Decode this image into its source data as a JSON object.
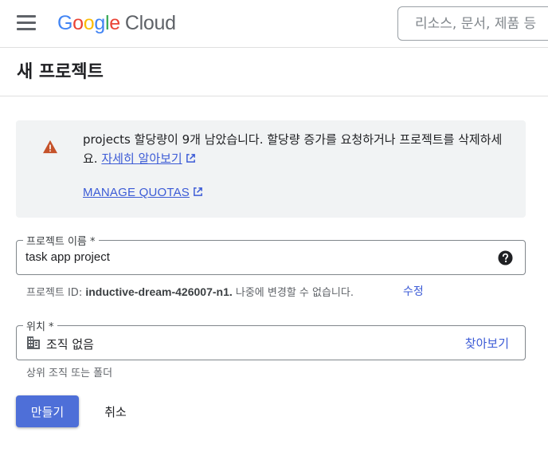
{
  "header": {
    "logo_google": [
      "G",
      "o",
      "o",
      "g",
      "l",
      "e"
    ],
    "logo_google_colors": [
      "#4285F4",
      "#EA4335",
      "#FBBC05",
      "#4285F4",
      "#34A853",
      "#EA4335"
    ],
    "logo_cloud": "Cloud",
    "search_placeholder": "리소스, 문서, 제품 등"
  },
  "page": {
    "title": "새 프로젝트"
  },
  "banner": {
    "message": "projects 할당량이 9개 남았습니다. 할당량 증가를 요청하거나 프로젝트를 삭제하세요.",
    "learn_more": "자세히 알아보기",
    "manage_quotas": "MANAGE QUOTAS",
    "warning_color": "#c5522a"
  },
  "project_name": {
    "label": "프로젝트 이름 *",
    "value": "task app project"
  },
  "project_id": {
    "prefix": "프로젝트 ID:",
    "value": "inductive-dream-426007-n1.",
    "suffix": "나중에 변경할 수 없습니다.",
    "edit": "수정"
  },
  "location": {
    "label": "위치 *",
    "value": "조직 없음",
    "browse": "찾아보기",
    "hint": "상위 조직 또는 폴더"
  },
  "actions": {
    "create": "만들기",
    "cancel": "취소"
  },
  "colors": {
    "accent": "#3c5bd6",
    "primary_button": "#4e6fd8"
  }
}
